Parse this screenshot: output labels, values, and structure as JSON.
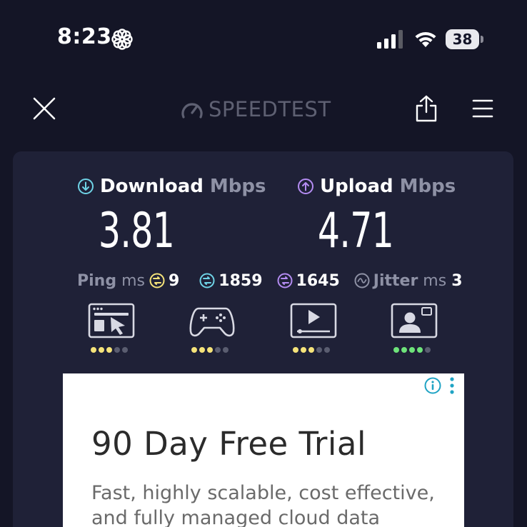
{
  "status_bar": {
    "time": "8:23",
    "battery": "38"
  },
  "header": {
    "logo_text": "SPEEDTEST",
    "close_icon": "close-icon",
    "share_icon": "share-icon",
    "menu_icon": "menu-icon"
  },
  "results": {
    "download": {
      "label": "Download",
      "unit": "Mbps",
      "value": "3.81"
    },
    "upload": {
      "label": "Upload",
      "unit": "Mbps",
      "value": "4.71"
    },
    "ping": {
      "label": "Ping",
      "unit": "ms",
      "idle": "9",
      "download": "1859",
      "upload": "1645"
    },
    "jitter": {
      "label": "Jitter",
      "unit": "ms",
      "value": "3"
    }
  },
  "quality": [
    {
      "icon": "web-browsing-icon",
      "rating": 3,
      "max": 5,
      "color": "#f5e37a"
    },
    {
      "icon": "gaming-icon",
      "rating": 3,
      "max": 5,
      "color": "#f5e37a"
    },
    {
      "icon": "video-streaming-icon",
      "rating": 3,
      "max": 5,
      "color": "#f5e37a"
    },
    {
      "icon": "video-call-icon",
      "rating": 4,
      "max": 5,
      "color": "#6ee37a"
    }
  ],
  "ad": {
    "title": "90 Day Free Trial",
    "body": "Fast, highly scalable, cost effective, and fully managed cloud data"
  },
  "colors": {
    "background": "#141526",
    "card": "#1f2137",
    "download_accent": "#6fd3e6",
    "upload_accent": "#b48cf2",
    "ping_accent": "#f5e37a",
    "muted": "#8e91a5"
  }
}
